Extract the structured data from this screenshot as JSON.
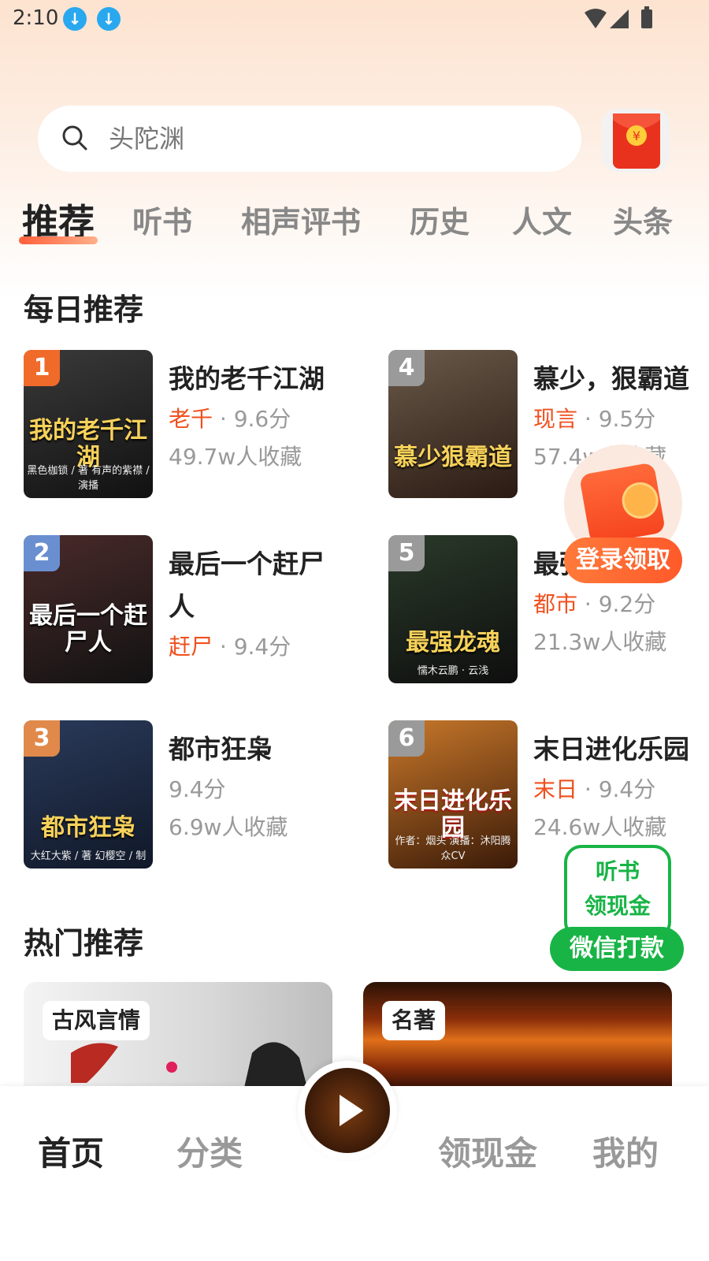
{
  "status_bar": {
    "time": "2:10"
  },
  "search": {
    "placeholder": "头陀渊"
  },
  "tabs": [
    {
      "label": "推荐",
      "active": true
    },
    {
      "label": "听书"
    },
    {
      "label": "相声评书"
    },
    {
      "label": "历史"
    },
    {
      "label": "人文"
    },
    {
      "label": "头条"
    }
  ],
  "daily": {
    "title": "每日推荐",
    "books": [
      {
        "rank": "1",
        "title": "我的老千江湖",
        "tag": "老千",
        "score": "9.6分",
        "favs": "49.7w人收藏",
        "cover_text": "我的老千江湖",
        "cover_sub": "黑色枷锁 / 著  有声的紫襟 / 演播"
      },
      {
        "rank": "2",
        "title": "最后一个赶尸人",
        "tag": "赶尸",
        "score": "9.4分",
        "favs": "",
        "cover_text": "最后一个赶尸人",
        "cover_sub": ""
      },
      {
        "rank": "3",
        "title": "都市狂枭",
        "tag": "",
        "score": "9.4分",
        "favs": "6.9w人收藏",
        "cover_text": "都市狂枭",
        "cover_sub": "大红大紫 / 著  幻樱空 / 制"
      },
      {
        "rank": "4",
        "title": "慕少，狠霸道",
        "tag": "现言",
        "score": "9.5分",
        "favs": "57.4w人收藏",
        "cover_text": "慕少狠霸道",
        "cover_sub": ""
      },
      {
        "rank": "5",
        "title": "最强龙魂",
        "tag": "都市",
        "score": "9.2分",
        "favs": "21.3w人收藏",
        "cover_text": "最强龙魂",
        "cover_sub": "懦木云鹏 · 云浅"
      },
      {
        "rank": "6",
        "title": "末日进化乐园",
        "tag": "末日",
        "score": "9.4分",
        "favs": "24.6w人收藏",
        "cover_text": "末日进化乐园",
        "cover_sub": "作者：烟头  演播：沐阳腾众CV"
      }
    ]
  },
  "hot": {
    "title": "热门推荐",
    "cards": [
      {
        "tag": "古风言情"
      },
      {
        "tag": "名著"
      }
    ]
  },
  "float_redpacket": {
    "label": "登录领取"
  },
  "listen_widget": {
    "line1": "听书",
    "line2": "领现金",
    "button": "微信打款"
  },
  "bottom_nav": [
    {
      "label": "首页",
      "active": true
    },
    {
      "label": "分类"
    },
    {
      "label": "领现金"
    },
    {
      "label": "我的"
    }
  ],
  "colors": {
    "accent": "#f0501e",
    "wechat_green": "#18b446",
    "rank_1": "#f06a2a",
    "rank_2": "#6a8fd0",
    "rank_3": "#e0894a",
    "rank_other": "#9a9a9a"
  }
}
